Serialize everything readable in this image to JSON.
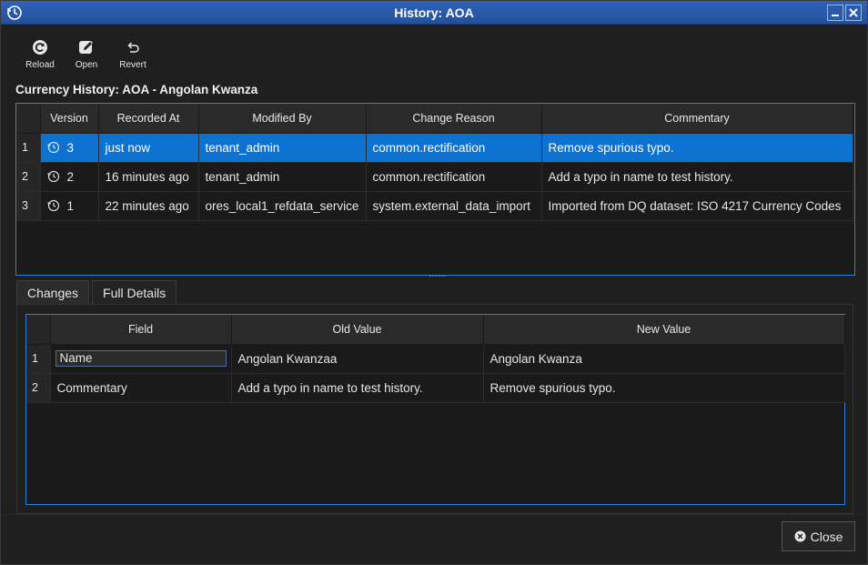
{
  "window": {
    "title": "History: AOA"
  },
  "toolbar": {
    "reload_label": "Reload",
    "open_label": "Open",
    "revert_label": "Revert"
  },
  "heading": "Currency History: AOA - Angolan Kwanza",
  "history_table": {
    "columns": [
      "Version",
      "Recorded At",
      "Modified By",
      "Change Reason",
      "Commentary"
    ],
    "rows": [
      {
        "num": "1",
        "version": "3",
        "recorded_at": "just now",
        "modified_by": "tenant_admin",
        "change_reason": "common.rectification",
        "commentary": "Remove spurious typo."
      },
      {
        "num": "2",
        "version": "2",
        "recorded_at": "16 minutes ago",
        "modified_by": "tenant_admin",
        "change_reason": "common.rectification",
        "commentary": "Add a typo in name to test history."
      },
      {
        "num": "3",
        "version": "1",
        "recorded_at": "22 minutes ago",
        "modified_by": "ores_local1_refdata_service",
        "change_reason": "system.external_data_import",
        "commentary": "Imported from DQ dataset: ISO 4217 Currency Codes"
      }
    ],
    "selected_row": 1
  },
  "tabs": [
    {
      "label": "Changes",
      "active": true
    },
    {
      "label": "Full Details",
      "active": false
    }
  ],
  "changes_table": {
    "columns": [
      "Field",
      "Old Value",
      "New Value"
    ],
    "rows": [
      {
        "num": "1",
        "field": "Name",
        "old_value": "Angolan Kwanzaa",
        "new_value": "Angolan Kwanza"
      },
      {
        "num": "2",
        "field": "Commentary",
        "old_value": "Add a typo in name to test history.",
        "new_value": "Remove spurious typo."
      }
    ]
  },
  "footer": {
    "close_label": "Close"
  },
  "colors": {
    "titlebar": "#2f63b8",
    "selection": "#0e73d0",
    "frame_border": "#2f7fd6",
    "background": "#1f1f1f"
  },
  "icons": [
    "history-app-icon",
    "minimize-icon",
    "close-icon",
    "reload-icon",
    "edit-icon",
    "undo-icon",
    "history-icon"
  ]
}
